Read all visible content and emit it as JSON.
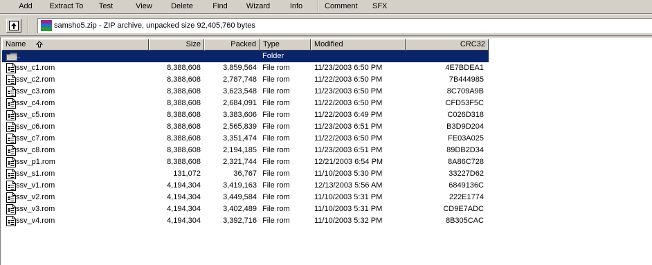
{
  "toolbar": {
    "buttons": [
      "Add",
      "Extract To",
      "Test",
      "View",
      "Delete",
      "Find",
      "Wizard",
      "Info",
      "Comment",
      "SFX"
    ]
  },
  "address": {
    "path": "samsho5.zip - ZIP archive, unpacked size 92,405,760 bytes"
  },
  "columns": {
    "name": "Name",
    "size": "Size",
    "packed": "Packed",
    "type": "Type",
    "modified": "Modified",
    "crc": "CRC32"
  },
  "parent_row": {
    "name": "..",
    "type": "Folder"
  },
  "files": [
    {
      "name": "ssv_c1.rom",
      "size": "8,388,608",
      "packed": "3,859,564",
      "type": "File rom",
      "modified": "11/23/2003 6:50 PM",
      "crc": "4E7BDEA1"
    },
    {
      "name": "ssv_c2.rom",
      "size": "8,388,608",
      "packed": "2,787,748",
      "type": "File rom",
      "modified": "11/22/2003 6:50 PM",
      "crc": "7B444985"
    },
    {
      "name": "ssv_c3.rom",
      "size": "8,388,608",
      "packed": "3,623,548",
      "type": "File rom",
      "modified": "11/23/2003 6:50 PM",
      "crc": "8C709A9B"
    },
    {
      "name": "ssv_c4.rom",
      "size": "8,388,608",
      "packed": "2,684,091",
      "type": "File rom",
      "modified": "11/22/2003 6:50 PM",
      "crc": "CFD53F5C"
    },
    {
      "name": "ssv_c5.rom",
      "size": "8,388,608",
      "packed": "3,383,606",
      "type": "File rom",
      "modified": "11/22/2003 6:49 PM",
      "crc": "C026D318"
    },
    {
      "name": "ssv_c6.rom",
      "size": "8,388,608",
      "packed": "2,565,839",
      "type": "File rom",
      "modified": "11/23/2003 6:51 PM",
      "crc": "B3D9D204"
    },
    {
      "name": "ssv_c7.rom",
      "size": "8,388,608",
      "packed": "3,351,474",
      "type": "File rom",
      "modified": "11/22/2003 6:50 PM",
      "crc": "FE03A025"
    },
    {
      "name": "ssv_c8.rom",
      "size": "8,388,608",
      "packed": "2,194,185",
      "type": "File rom",
      "modified": "11/23/2003 6:51 PM",
      "crc": "89DB2D34"
    },
    {
      "name": "ssv_p1.rom",
      "size": "8,388,608",
      "packed": "2,321,744",
      "type": "File rom",
      "modified": "12/21/2003 6:54 PM",
      "crc": "8A86C728"
    },
    {
      "name": "ssv_s1.rom",
      "size": "131,072",
      "packed": "36,767",
      "type": "File rom",
      "modified": "11/10/2003 5:30 PM",
      "crc": "33227D62"
    },
    {
      "name": "ssv_v1.rom",
      "size": "4,194,304",
      "packed": "3,419,163",
      "type": "File rom",
      "modified": "12/13/2003 5:56 AM",
      "crc": "6849136C"
    },
    {
      "name": "ssv_v2.rom",
      "size": "4,194,304",
      "packed": "3,449,584",
      "type": "File rom",
      "modified": "11/10/2003 5:31 PM",
      "crc": "222E1774"
    },
    {
      "name": "ssv_v3.rom",
      "size": "4,194,304",
      "packed": "3,402,489",
      "type": "File rom",
      "modified": "11/10/2003 5:31 PM",
      "crc": "CD9E7ADC"
    },
    {
      "name": "ssv_v4.rom",
      "size": "4,194,304",
      "packed": "3,392,716",
      "type": "File rom",
      "modified": "11/10/2003 5:32 PM",
      "crc": "8B305CAC"
    }
  ],
  "colors": {
    "selection": "#0a246a",
    "face": "#d4d0c8"
  }
}
